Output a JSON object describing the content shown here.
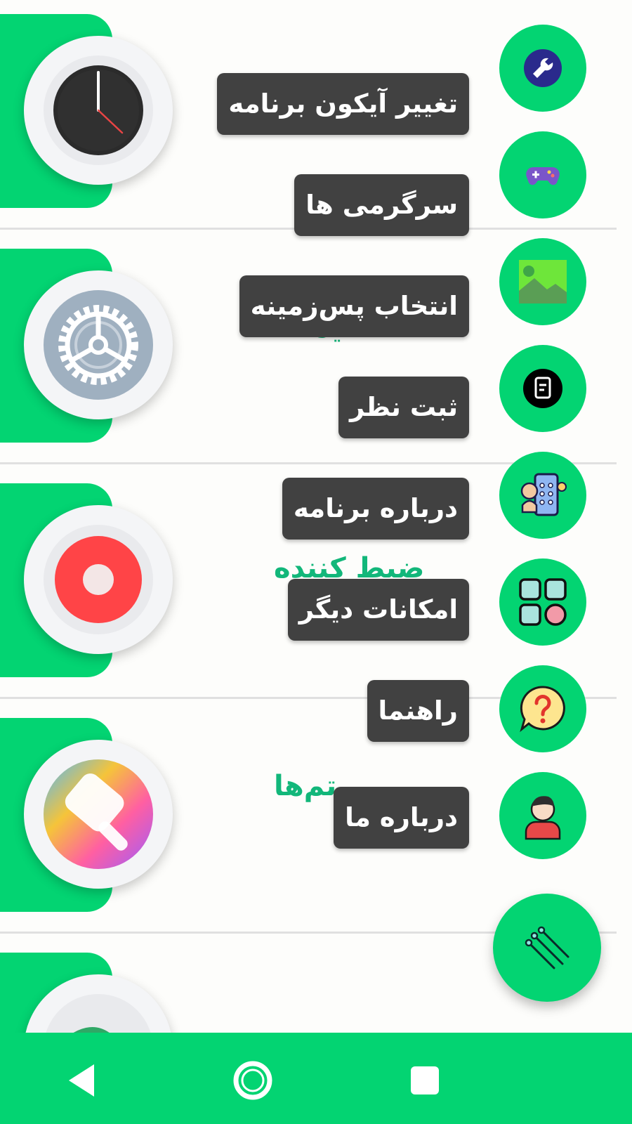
{
  "app": {
    "accent_color": "#03d472",
    "label_bg": "#414141",
    "title_color": "#12b77a"
  },
  "list": {
    "rows": [
      {
        "title": "",
        "icon": "clock-icon"
      },
      {
        "title": "تنظیمات",
        "icon": "settings-gear-icon"
      },
      {
        "title": "ضبط کننده",
        "icon": "record-icon"
      },
      {
        "title": "تم‌ها",
        "icon": "paint-brush-icon"
      },
      {
        "title": "",
        "icon": "partial-app-icon"
      }
    ]
  },
  "speed_dial": {
    "items": [
      {
        "label": "تغییر آیکون برنامه",
        "icon": "wrench-icon"
      },
      {
        "label": "سرگرمی ها",
        "icon": "gamepad-icon"
      },
      {
        "label": "انتخاب پس‌زمینه",
        "icon": "image-icon"
      },
      {
        "label": "ثبت نظر",
        "icon": "note-icon"
      },
      {
        "label": "درباره برنامه",
        "icon": "phone-app-icon"
      },
      {
        "label": "امکانات دیگر",
        "icon": "grid-apps-icon"
      },
      {
        "label": "راهنما",
        "icon": "help-bubble-icon"
      },
      {
        "label": "درباره ما",
        "icon": "user-avatar-icon"
      }
    ],
    "main_icon": "sparkle-stars-icon"
  },
  "navbar": {
    "back": "back-icon",
    "home": "home-icon",
    "recents": "recents-icon"
  }
}
